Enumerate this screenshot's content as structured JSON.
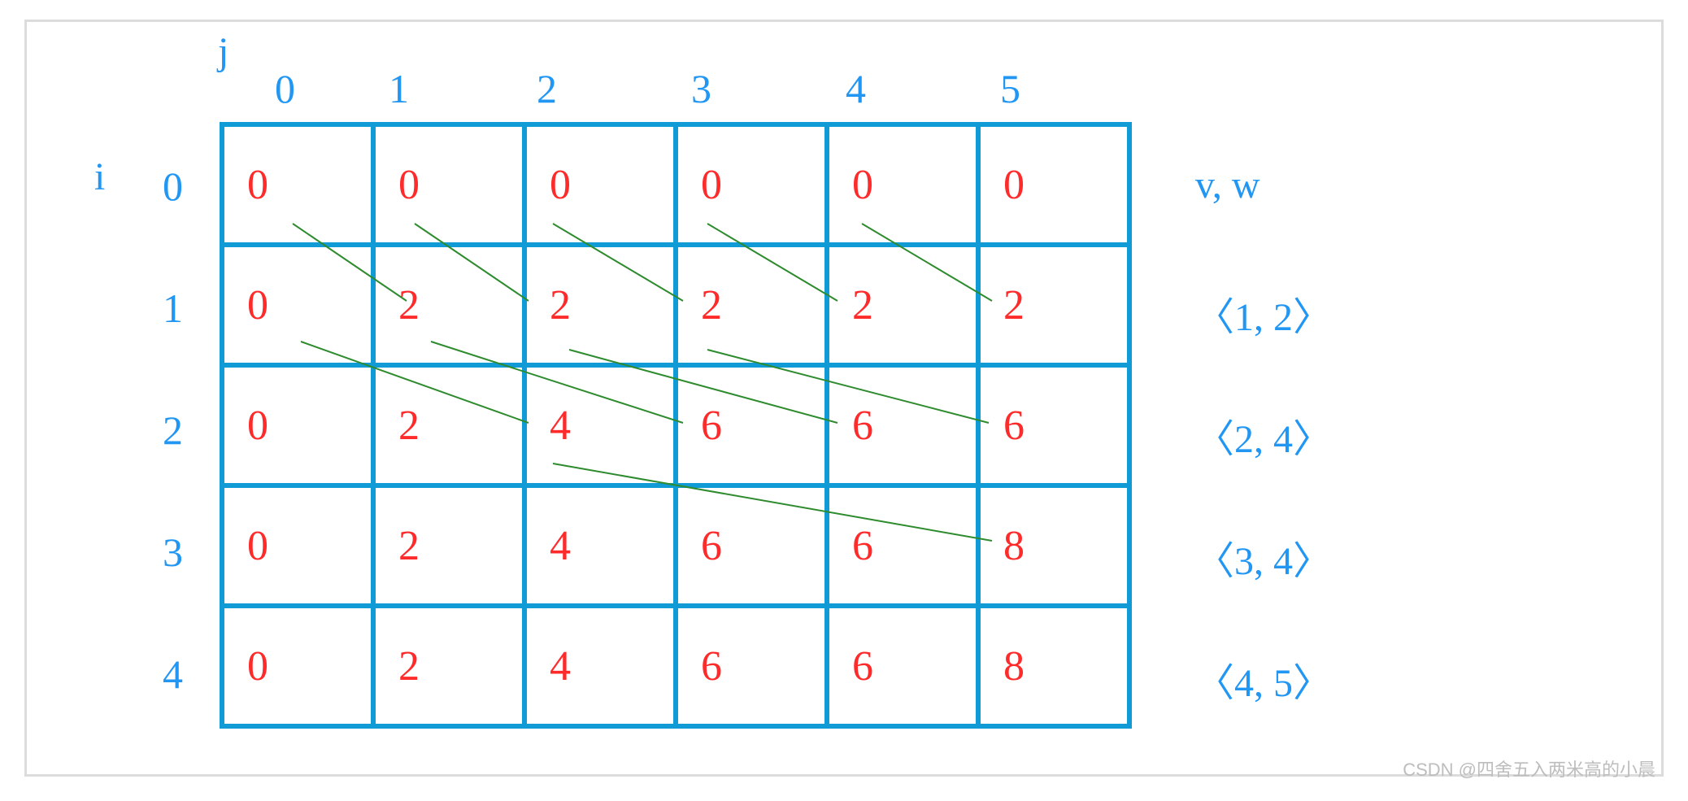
{
  "labels": {
    "j": "j",
    "i": "i",
    "vw_header": "v, w"
  },
  "col_headers": [
    "0",
    "1",
    "2",
    "3",
    "4",
    "5"
  ],
  "row_headers": [
    "0",
    "1",
    "2",
    "3",
    "4"
  ],
  "right_labels": [
    "v, w",
    "〈1, 2〉",
    "〈2, 4〉",
    "〈3, 4〉",
    "〈4, 5〉"
  ],
  "grid": [
    [
      "0",
      "0",
      "0",
      "0",
      "0",
      "0"
    ],
    [
      "0",
      "2",
      "2",
      "2",
      "2",
      "2"
    ],
    [
      "0",
      "2",
      "4",
      "6",
      "6",
      "6"
    ],
    [
      "0",
      "2",
      "4",
      "6",
      "6",
      "8"
    ],
    [
      "0",
      "2",
      "4",
      "6",
      "6",
      "8"
    ]
  ],
  "watermark": "CSDN @四舍五入两米高的小晨",
  "chart_data": {
    "type": "table",
    "title": "DP table (0/1 knapsack-style)",
    "row_index_name": "i",
    "col_index_name": "j",
    "columns": [
      0,
      1,
      2,
      3,
      4,
      5
    ],
    "rows": [
      0,
      1,
      2,
      3,
      4
    ],
    "values": [
      [
        0,
        0,
        0,
        0,
        0,
        0
      ],
      [
        0,
        2,
        2,
        2,
        2,
        2
      ],
      [
        0,
        2,
        4,
        6,
        6,
        6
      ],
      [
        0,
        2,
        4,
        6,
        6,
        8
      ],
      [
        0,
        2,
        4,
        6,
        6,
        8
      ]
    ],
    "row_annotations": {
      "label": "v, w",
      "pairs": [
        [
          1,
          2
        ],
        [
          2,
          4
        ],
        [
          3,
          4
        ],
        [
          4,
          5
        ]
      ]
    }
  }
}
